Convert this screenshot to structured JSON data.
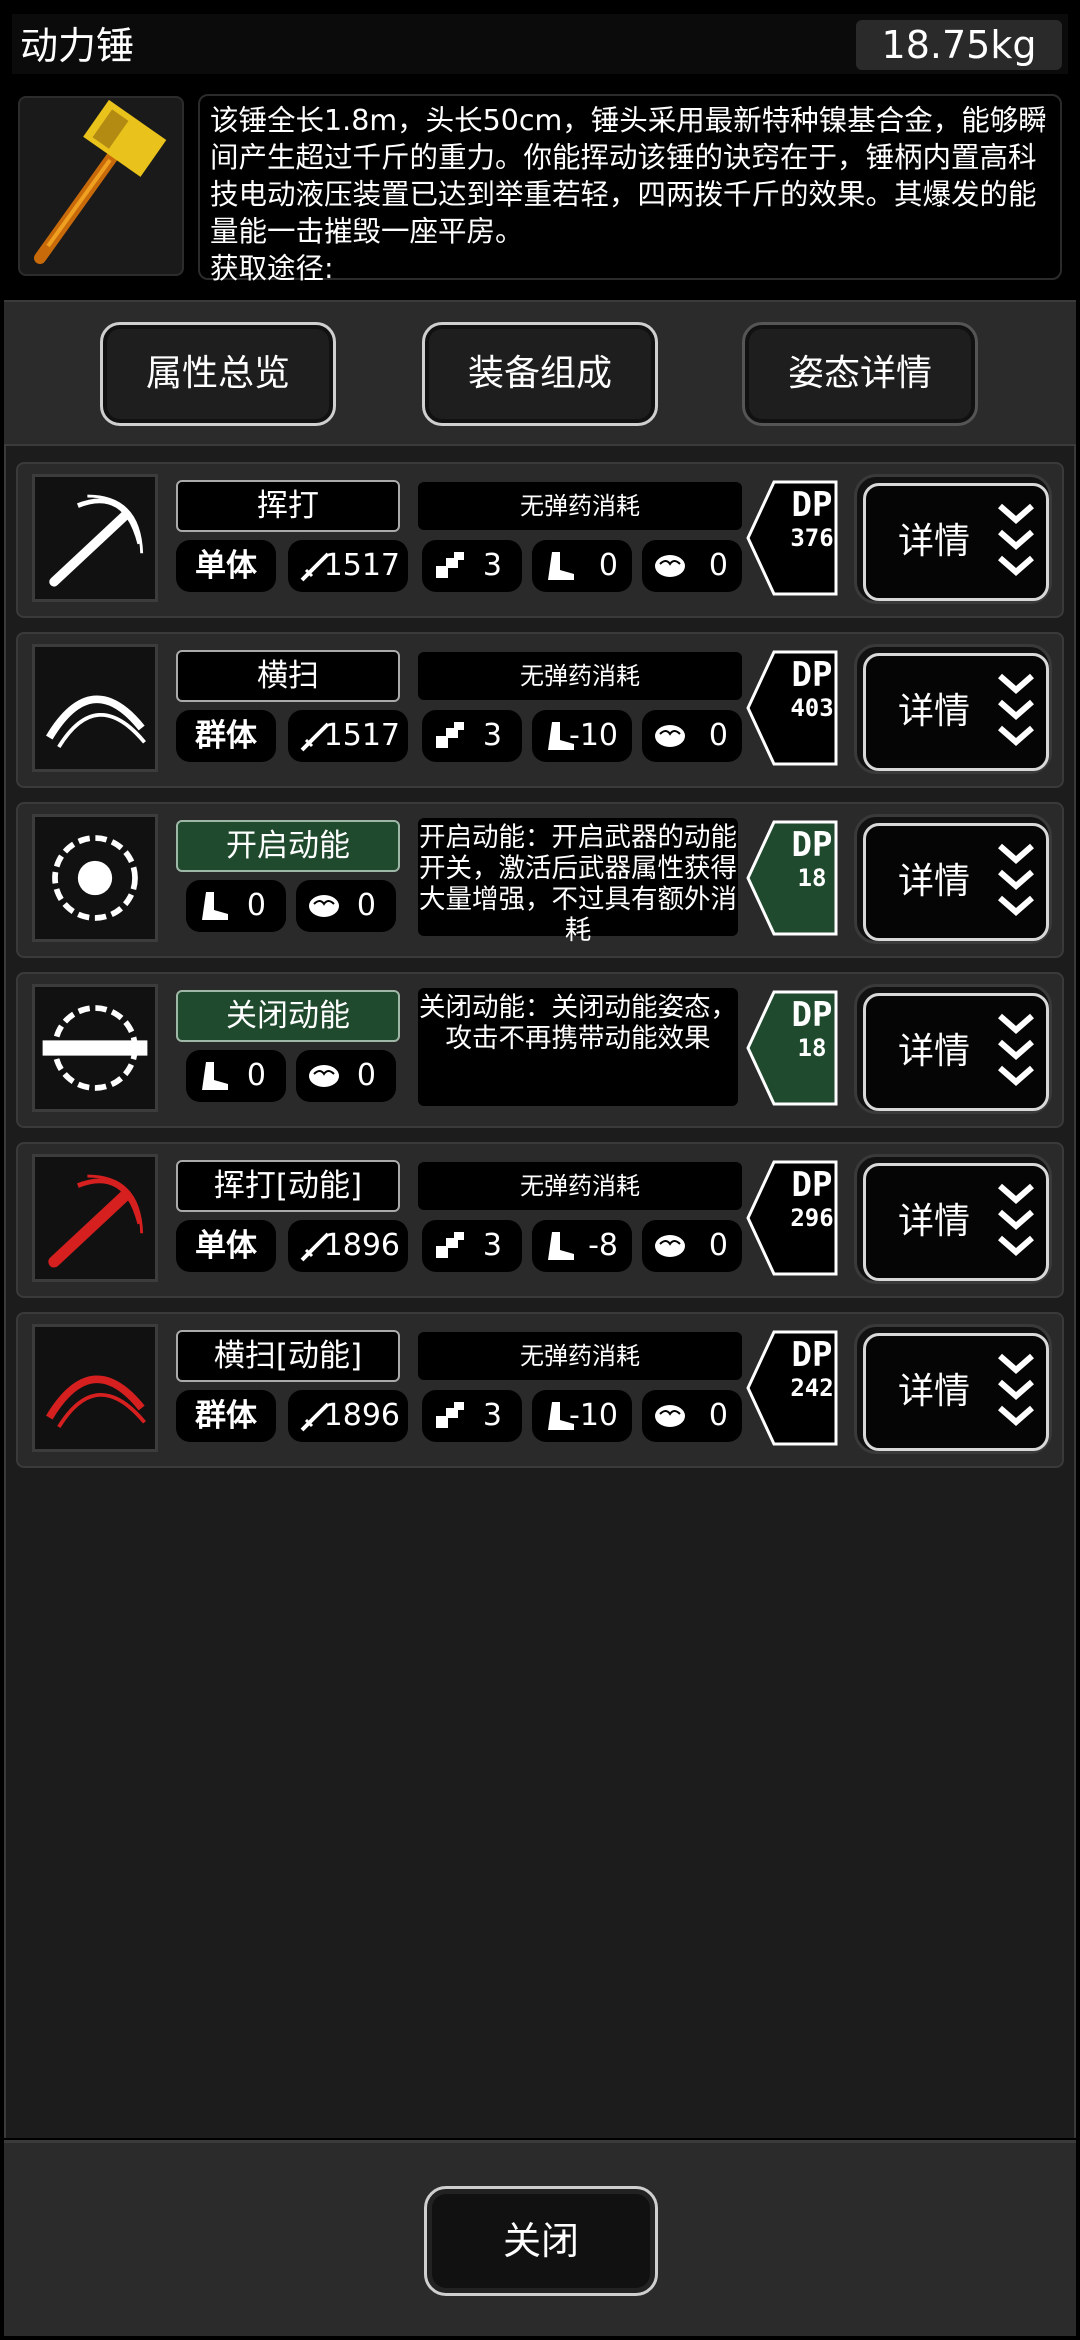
{
  "header": {
    "title": "动力锤",
    "weight": "18.75kg",
    "description": "该锤全长1.8m，头长50cm，锤头采用最新特种镍基合金，能够瞬间产生超过千斤的重力。你能挥动该锤的诀窍在于，锤柄内置高科技电动液压装置已达到举重若轻，四两拨千斤的效果。其爆发的能量能一击摧毁一座平房。\n获取途径:"
  },
  "tabs": [
    {
      "label": "属性总览",
      "active": true
    },
    {
      "label": "装备组成",
      "active": true
    },
    {
      "label": "姿态详情",
      "active": false
    }
  ],
  "rows": [
    {
      "name": "挥打",
      "ammo": "无弹药消耗",
      "type": "单体",
      "atk": "1517",
      "hits": "3",
      "move": "0",
      "mind": "0",
      "dp_top": "DP",
      "dp": "376",
      "detail": "详情",
      "icon": "swing-icon"
    },
    {
      "name": "横扫",
      "ammo": "无弹药消耗",
      "type": "群体",
      "atk": "1517",
      "hits": "3",
      "move": "-10",
      "mind": "0",
      "dp_top": "DP",
      "dp": "403",
      "detail": "详情",
      "icon": "sweep-icon"
    },
    {
      "name": "开启动能",
      "note": "开启动能：开启武器的动能开关，激活后武器属性获得大量增强，不过具有额外消耗",
      "move": "0",
      "mind": "0",
      "dp_top": "DP",
      "dp": "18",
      "detail": "详情",
      "icon": "power-on-icon"
    },
    {
      "name": "关闭动能",
      "note": "关闭动能：关闭动能姿态，攻击不再携带动能效果",
      "move": "0",
      "mind": "0",
      "dp_top": "DP",
      "dp": "18",
      "detail": "详情",
      "icon": "power-off-icon"
    },
    {
      "name": "挥打[动能]",
      "ammo": "无弹药消耗",
      "type": "单体",
      "atk": "1896",
      "hits": "3",
      "move": "-8",
      "mind": "0",
      "dp_top": "DP",
      "dp": "296",
      "detail": "详情",
      "icon": "red-swing-icon"
    },
    {
      "name": "横扫[动能]",
      "ammo": "无弹药消耗",
      "type": "群体",
      "atk": "1896",
      "hits": "3",
      "move": "-10",
      "mind": "0",
      "dp_top": "DP",
      "dp": "242",
      "detail": "详情",
      "icon": "red-sweep-icon"
    }
  ],
  "footer": {
    "close": "关闭"
  },
  "colors": {
    "accent_green": "#1f4a2e",
    "red_effect": "#d61f1f"
  }
}
